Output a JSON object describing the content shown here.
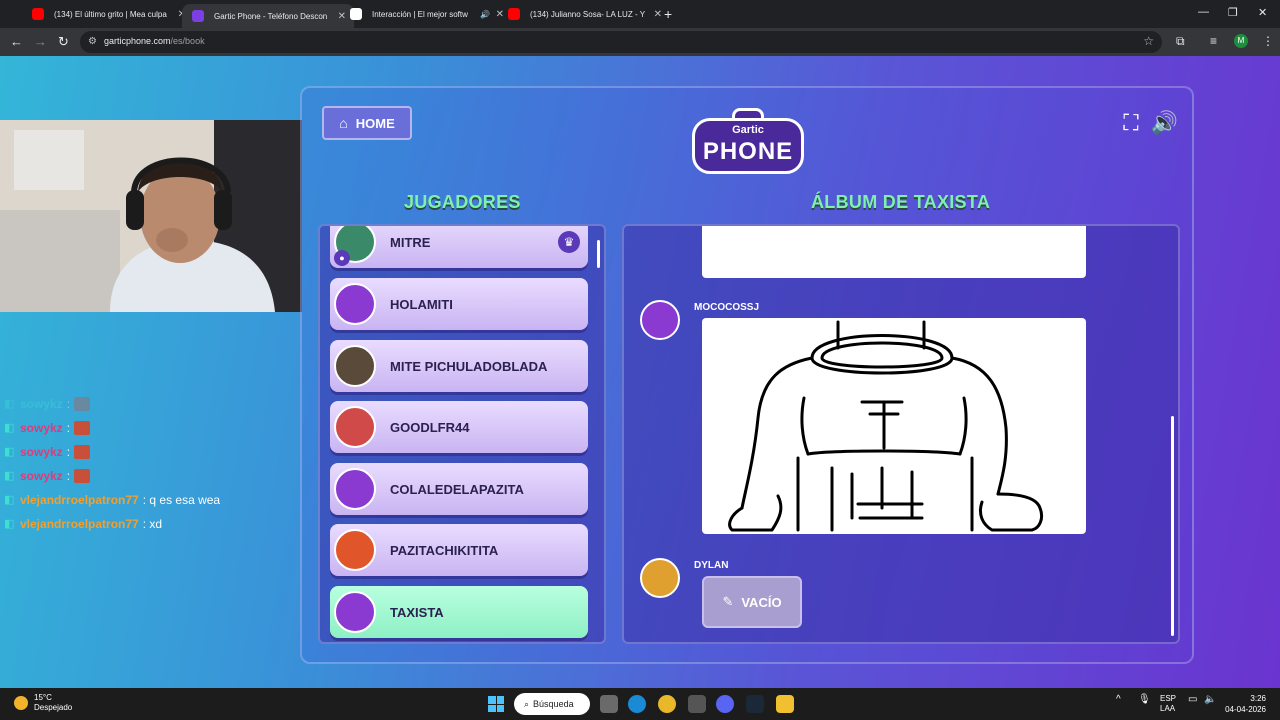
{
  "browser": {
    "tabs": [
      {
        "title": "(134) El último grito | Mea culpa",
        "favicon_color": "#ff0000"
      },
      {
        "title": "Gartic Phone - Teléfono Descon",
        "favicon_color": "#7b3fe4"
      },
      {
        "title": "Interacción | El mejor softw",
        "favicon_color": "#ffffff"
      },
      {
        "title": "(134) Julianno Sosa- LA LUZ - Y",
        "favicon_color": "#ff0000"
      }
    ],
    "url_host": "garticphone.com",
    "url_path": "/es/book",
    "profile_initial": "M"
  },
  "chat": {
    "lines": [
      {
        "user": "sowykz",
        "message": "",
        "emote": true,
        "faded": true,
        "user_color": "#3de0d0"
      },
      {
        "user": "sowykz",
        "message": "",
        "emote": true,
        "faded": false,
        "user_color": "#e03a7a"
      },
      {
        "user": "sowykz",
        "message": "",
        "emote": true,
        "faded": false,
        "user_color": "#e03a7a"
      },
      {
        "user": "sowykz",
        "message": "",
        "emote": true,
        "faded": false,
        "user_color": "#e03a7a"
      },
      {
        "user": "vlejandrroelpatron77",
        "message": ": q es esa wea",
        "emote": false,
        "faded": false,
        "user_color": "#f0a030"
      },
      {
        "user": "vlejandrroelpatron77",
        "message": ": xd",
        "emote": false,
        "faded": false,
        "user_color": "#f0a030"
      }
    ]
  },
  "game": {
    "home_label": "HOME",
    "logo_top": "Gartic",
    "logo_bottom": "PHONE",
    "players_heading": "JUGADORES",
    "album_heading": "ÁLBUM DE TAXISTA",
    "players": [
      {
        "name": "MITRE",
        "avatar_color": "#3a8a6a",
        "crown": true,
        "host": true,
        "active": false
      },
      {
        "name": "HOLAMITI",
        "avatar_color": "#8a3ad0",
        "crown": false,
        "host": false,
        "active": false
      },
      {
        "name": "MITE PICHULADOBLADA",
        "avatar_color": "#5a4a3a",
        "crown": false,
        "host": false,
        "active": false
      },
      {
        "name": "GOODLFR44",
        "avatar_color": "#d04a4a",
        "crown": false,
        "host": false,
        "active": false
      },
      {
        "name": "COLALEDELAPAZITA",
        "avatar_color": "#8a3ad0",
        "crown": false,
        "host": false,
        "active": false
      },
      {
        "name": "PAZITACHIKITITA",
        "avatar_color": "#e0552a",
        "crown": false,
        "host": false,
        "active": false
      },
      {
        "name": "TAXISTA",
        "avatar_color": "#8a3ad0",
        "crown": false,
        "host": false,
        "active": true
      }
    ],
    "album": {
      "entries": [
        {
          "author": "MOCOCOSSJ",
          "avatar_color": "#8a3ad0",
          "type": "drawing"
        },
        {
          "author": "DYLAN",
          "avatar_color": "#e0a030",
          "type": "empty",
          "empty_label": "VACÍO"
        }
      ]
    }
  },
  "taskbar": {
    "weather_temp": "15°C",
    "weather_desc": "Despejado",
    "search_label": "Búsqueda",
    "lang_top": "ESP",
    "lang_bottom": "LAA",
    "time": "3:26",
    "date": "04-04-2026"
  }
}
